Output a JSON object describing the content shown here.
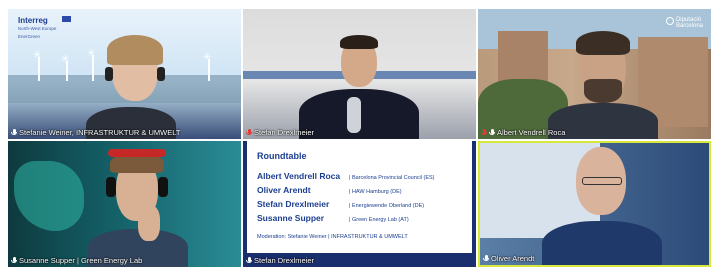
{
  "participants": [
    {
      "name": "Stefanie Weiner, INFRASTRUKTUR & UMWELT",
      "muted": false
    },
    {
      "name": "Stefan Drexlmeier",
      "muted": true
    },
    {
      "name": "Albert Vendrell Roca",
      "muted": true
    },
    {
      "name": "Susanne Supper | Green Energy Lab",
      "muted": false
    },
    {
      "name": "Stefan Drexlmeier",
      "muted": false
    },
    {
      "name": "Oliver Arendt",
      "muted": false
    }
  ],
  "branding": {
    "interreg_logo": {
      "line1": "Interreg",
      "line2": "North-West Europe",
      "line3": "EnerGreen"
    },
    "diputacio_logo": {
      "line1": "Diputació",
      "line2": "Barcelona"
    }
  },
  "roundtable": {
    "title": "Roundtable",
    "panelists": [
      {
        "name": "Albert Vendrell Roca",
        "org": "| Barcelona Provincial Council (ES)"
      },
      {
        "name": "Oliver Arendt",
        "org": "| HAW Hamburg (DE)"
      },
      {
        "name": "Stefan Drexlmeier",
        "org": "| Energiewende Oberland (DE)"
      },
      {
        "name": "Susanne Supper",
        "org": "| Green Energy Lab (AT)"
      }
    ],
    "moderation": "Moderation: Stefanie Weiner | INFRASTRUKTUR & UMWELT"
  },
  "colors": {
    "active_speaker_border": "#d8e83a",
    "muted_mic": "#e53935",
    "roundtable_text": "#1c3f8f"
  }
}
